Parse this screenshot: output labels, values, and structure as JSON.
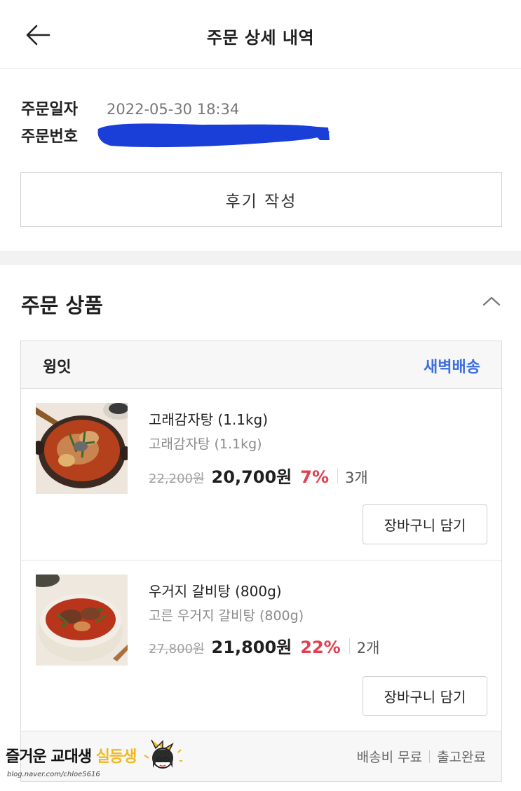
{
  "header": {
    "title": "주문 상세 내역",
    "back_icon": "arrow-left-icon"
  },
  "order_info": {
    "date_label": "주문일자",
    "date_value": "2022-05-30 18:34",
    "number_label": "주문번호",
    "number_redaction_color": "#1a3fd9"
  },
  "review_button_label": "후기 작성",
  "section": {
    "title": "주문 상품",
    "collapse_icon": "chevron-up-icon"
  },
  "seller": {
    "name": "윙잇",
    "delivery_type": "새벽배송",
    "delivery_color": "#3d6fe0"
  },
  "items": [
    {
      "name": "고래감자탕 (1.1kg)",
      "option": "고래감자탕 (1.1kg)",
      "original_price": "22,200원",
      "sale_price": "20,700원",
      "discount": "7%",
      "quantity": "3개",
      "cart_label": "장바구니 담기",
      "image": "gamjatang-photo"
    },
    {
      "name": "우거지 갈비탕 (800g)",
      "option": "고른 우거지 갈비탕 (800g)",
      "original_price": "27,800원",
      "sale_price": "21,800원",
      "discount": "22%",
      "quantity": "2개",
      "cart_label": "장바구니 담기",
      "image": "galbitang-photo"
    }
  ],
  "footer": {
    "shipping": "배송비 무료",
    "status": "출고완료"
  },
  "watermark": {
    "text_main": "즐거운 교대생 ",
    "text_accent": "실등생",
    "url": "blog.naver.com/chloe5616"
  },
  "colors": {
    "discount": "#e0404f",
    "divider_band": "#f2f2f2"
  }
}
